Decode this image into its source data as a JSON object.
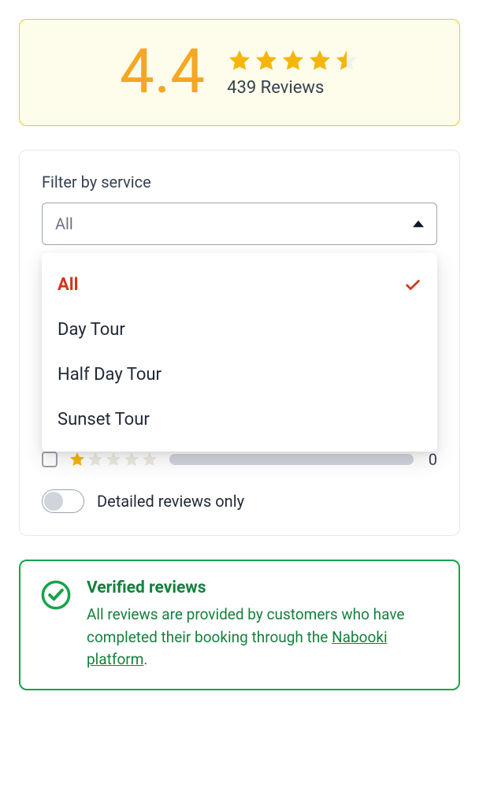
{
  "rating": {
    "score": "4.4",
    "review_count_label": "439 Reviews",
    "stars_value": 4.5
  },
  "filter": {
    "label": "Filter by service",
    "selected": "All",
    "options": [
      {
        "label": "All",
        "selected": true
      },
      {
        "label": "Day Tour",
        "selected": false
      },
      {
        "label": "Half Day Tour",
        "selected": false
      },
      {
        "label": "Sunset Tour",
        "selected": false
      }
    ]
  },
  "bar_row": {
    "count": "0"
  },
  "toggle": {
    "label": "Detailed reviews only",
    "on": false
  },
  "verified": {
    "title": "Verified reviews",
    "text_prefix": "All reviews are provided by customers who have completed their booking through the ",
    "link_text": "Nabooki platform",
    "text_suffix": "."
  },
  "colors": {
    "gold": "#f5b50a",
    "gold_empty": "#e5e7eb",
    "green": "#16a34a",
    "red": "#d03818"
  }
}
